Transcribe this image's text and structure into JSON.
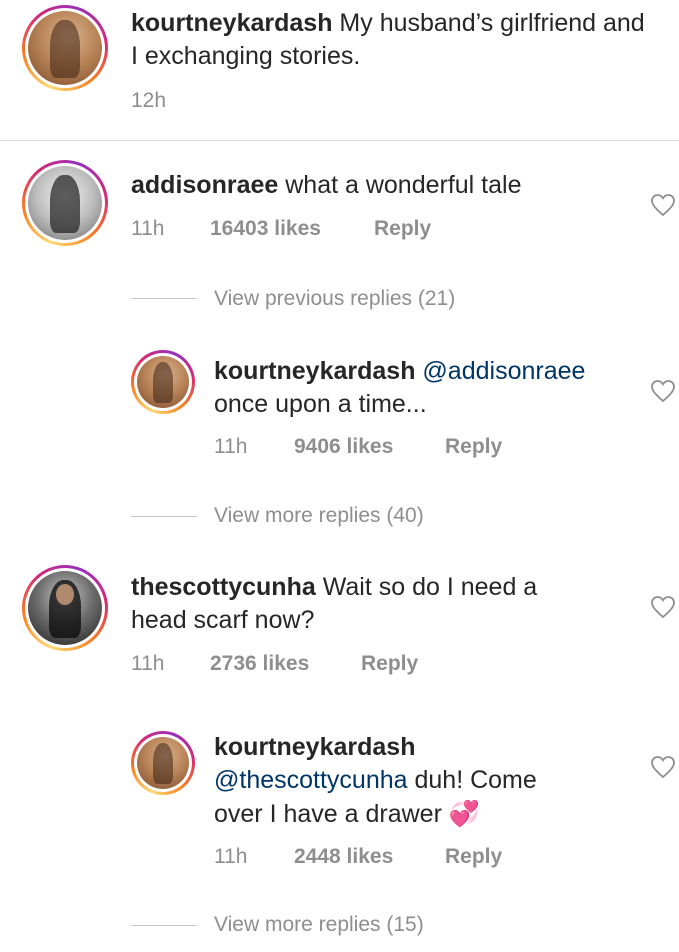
{
  "caption": {
    "username": "kourtneykardash",
    "text": "My husband’s girlfriend and I exchanging stories.",
    "time": "12h"
  },
  "comments": [
    {
      "username": "addisonraee",
      "text": "what a wonderful tale",
      "time": "11h",
      "likes": "16403 likes",
      "reply_label": "Reply",
      "view_replies": "View previous replies (21)"
    },
    {
      "username": "kourtneykardash",
      "mention": "@addisonraee",
      "text": "once upon a time...",
      "time": "11h",
      "likes": "9406 likes",
      "reply_label": "Reply",
      "view_replies": "View more replies (40)"
    },
    {
      "username": "thescottycunha",
      "text": "Wait so do I need a head scarf now?",
      "text_line1": "Wait so do I need a",
      "text_line2": "head scarf now?",
      "time": "11h",
      "likes": "2736 likes",
      "reply_label": "Reply"
    },
    {
      "username": "kourtneykardash",
      "mention": "@thescottycunha",
      "text_after_mention": "duh! Come",
      "text_line3": "over I have a drawer",
      "emoji": "💞",
      "time": "11h",
      "likes": "2448 likes",
      "reply_label": "Reply",
      "view_replies": "View more replies (15)"
    }
  ],
  "colors": {
    "text": "#262626",
    "meta": "#8e8e8e",
    "mention": "#003569"
  },
  "icons": {
    "like": "heart-outline-icon"
  }
}
